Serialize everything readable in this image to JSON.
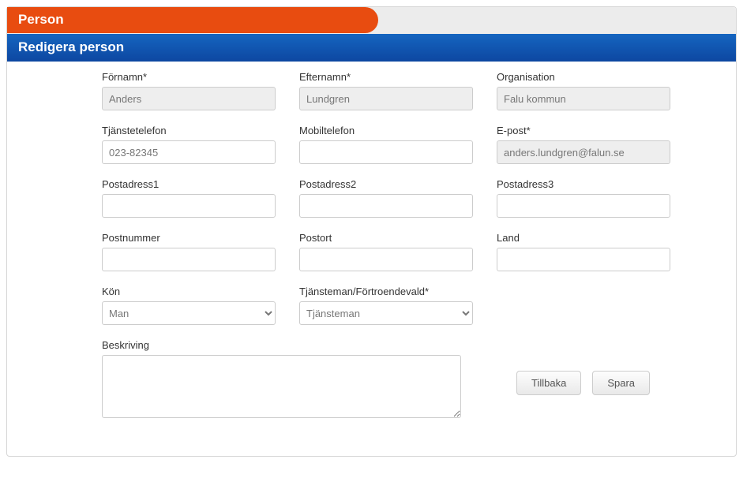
{
  "header": {
    "section_title": "Person",
    "sub_title": "Redigera person"
  },
  "labels": {
    "fornamn": "Förnamn*",
    "efternamn": "Efternamn*",
    "organisation": "Organisation",
    "tjanstetelefon": "Tjänstetelefon",
    "mobiltelefon": "Mobiltelefon",
    "epost": "E-post*",
    "postadress1": "Postadress1",
    "postadress2": "Postadress2",
    "postadress3": "Postadress3",
    "postnummer": "Postnummer",
    "postort": "Postort",
    "land": "Land",
    "kon": "Kön",
    "tjansteman": "Tjänsteman/Förtroendevald*",
    "beskrivning": "Beskriving"
  },
  "values": {
    "fornamn": "Anders",
    "efternamn": "Lundgren",
    "organisation": "Falu kommun",
    "tjanstetelefon": "023-82345",
    "mobiltelefon": "",
    "epost": "anders.lundgren@falun.se",
    "postadress1": "",
    "postadress2": "",
    "postadress3": "",
    "postnummer": "",
    "postort": "",
    "land": "",
    "kon_selected": "Man",
    "tjansteman_selected": "Tjänsteman",
    "beskrivning": ""
  },
  "options": {
    "kon": [
      "Man"
    ],
    "tjansteman": [
      "Tjänsteman"
    ]
  },
  "buttons": {
    "tillbaka": "Tillbaka",
    "spara": "Spara"
  }
}
